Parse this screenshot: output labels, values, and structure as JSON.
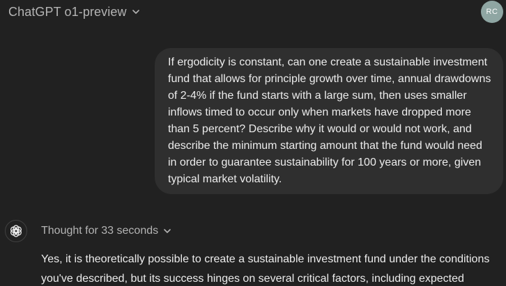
{
  "header": {
    "model_name": "ChatGPT o1-preview",
    "model_chevron_icon": "chevron-down-icon",
    "avatar_initials": "RC",
    "avatar_color": "#8fa6a3"
  },
  "conversation": {
    "user_message": "If ergodicity is constant, can one create a sustainable investment fund that allows for principle growth over time, annual drawdowns of 2-4% if the fund starts with a large sum, then uses smaller inflows timed to occur only when markets have dropped more than 5 percent? Describe why it would or would not work, and describe the minimum starting amount that the fund would need in order to guarantee sustainability for 100 years or more, given typical market volatility.",
    "assistant_icon": "openai-logo-icon",
    "thought_label": "Thought for 33 seconds",
    "assistant_message": "Yes, it is theoretically possible to create a sustainable investment fund under the conditions you've described, but its success hinges on several critical factors, including expected"
  },
  "colors": {
    "background": "#212121",
    "user_bubble": "#2f2f2f",
    "text": "#ececec",
    "muted_text": "#b4b4b4"
  }
}
